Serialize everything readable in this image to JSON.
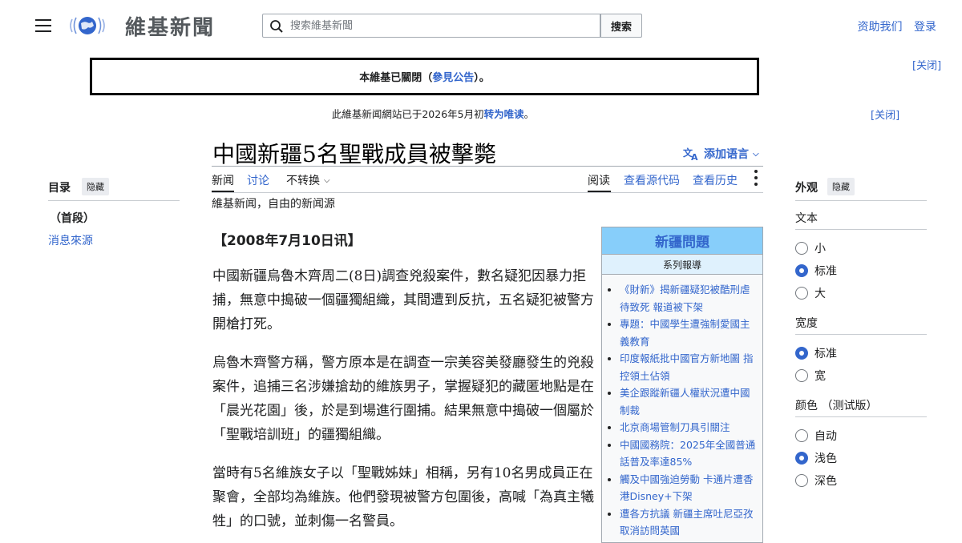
{
  "header": {
    "logo_text": "維基新聞",
    "search": {
      "placeholder": "搜索維基新聞",
      "button_label": "搜索"
    },
    "links": [
      "资助我们",
      "登录"
    ]
  },
  "notices": {
    "banner": {
      "prefix": "本維基已關閉（",
      "link": "參見公告",
      "suffix": "）。"
    },
    "banner_close": "[关闭]",
    "notice": {
      "prefix": "此維基新闻網站已于2026年5月初",
      "link": "转为唯读",
      "suffix": "。"
    },
    "notice_close": "[关闭]"
  },
  "toc": {
    "title": "目录",
    "hide_label": "隐藏",
    "items": [
      "（首段）",
      "消息來源"
    ]
  },
  "article": {
    "title": "中國新疆5名聖戰成員被擊斃",
    "add_languages": "添加语言",
    "tabs_left": [
      "新闻",
      "讨论",
      "不转换"
    ],
    "tabs_right": [
      "阅读",
      "查看源代码",
      "查看历史"
    ],
    "tagline": "維基新闻，自由的新闻源",
    "dateline": "【2008年7月10日讯】",
    "paragraphs": [
      "中國新疆烏魯木齊周二(8日)調查兇殺案件，數名疑犯因暴力拒捕，無意中搗破一個疆獨組織，其間遭到反抗，五名疑犯被警方開槍打死。",
      "烏魯木齊警方稱，警方原本是在調查一宗美容美發廳發生的兇殺案件，追捕三名涉嫌搶劫的維族男子，掌握疑犯的藏匿地點是在「晨光花園」後，於是到場進行圍捕。結果無意中搗破一個屬於「聖戰培訓班」的疆獨組織。",
      "當時有5名維族女子以「聖戰姊妹」相稱，另有10名男成員正在聚會，全部均為維族。他們發現被警方包圍後，高喊「為真主犧牲」的口號，並刺傷一名警員。"
    ]
  },
  "infobox": {
    "title": "新疆問題",
    "subtitle": "系列報導",
    "items": [
      "《財新》揭新疆疑犯被酷刑虐待致死 報道被下架",
      "專題：中國學生遭強制愛國主義教育",
      "印度報紙批中國官方新地圖 指控領土佔領",
      "美企跟蹤新疆人權狀況遭中國制裁",
      "北京商場管制刀具引關注",
      "中國國務院：2025年全國普通話普及率達85%",
      "觸及中國強迫勞動 卡通片遭香港Disney+下架",
      "遭各方抗議 新疆主席吐尼亞孜取消訪問英國"
    ]
  },
  "appearance": {
    "title": "外观",
    "hide_label": "隐藏",
    "text_label": "文本",
    "text_options": [
      "小",
      "标准",
      "大"
    ],
    "text_selected": "标准",
    "width_label": "宽度",
    "width_options": [
      "标准",
      "宽"
    ],
    "width_selected": "标准",
    "color_label": "颜色 （测试版）",
    "color_options": [
      "自动",
      "浅色",
      "深色"
    ],
    "color_selected": "浅色"
  },
  "colors": {
    "link": "#3366cc",
    "infobox_header": "#87cefa",
    "infobox_sub": "#dff1fd",
    "text": "#202122"
  }
}
